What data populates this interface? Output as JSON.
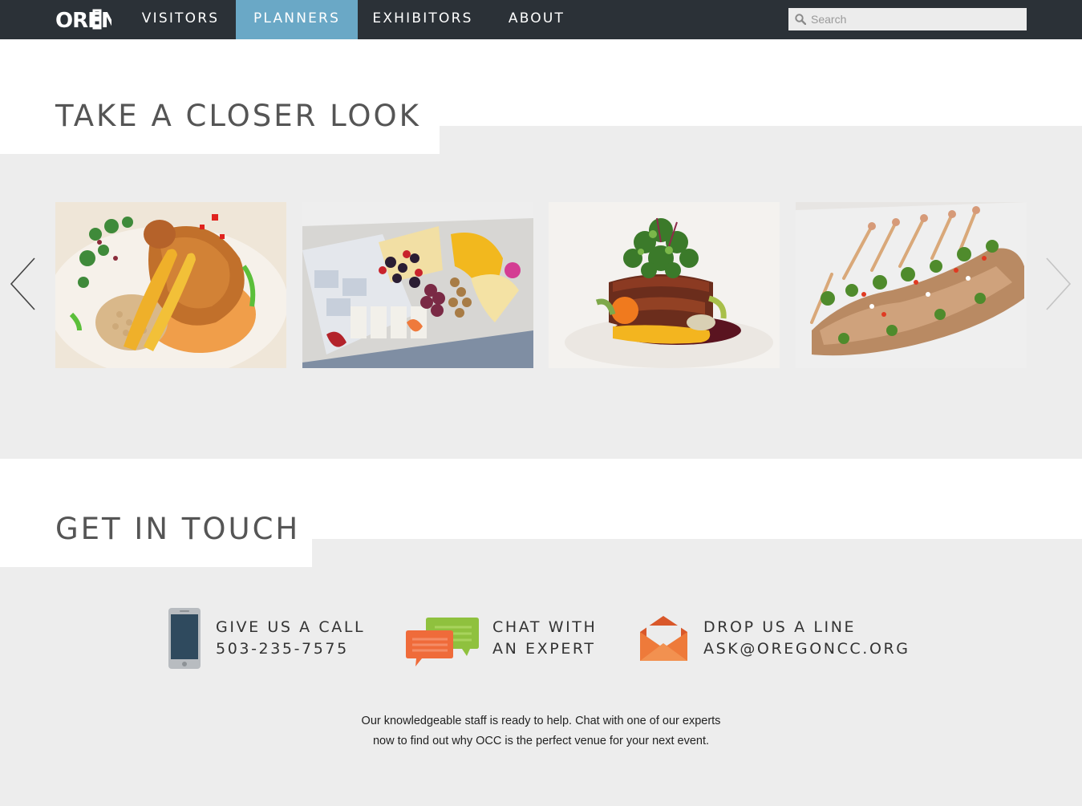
{
  "nav": {
    "logo_text": "OREGON",
    "items": [
      {
        "label": "VISITORS",
        "active": false
      },
      {
        "label": "PLANNERS",
        "active": true
      },
      {
        "label": "EXHIBITORS",
        "active": false
      },
      {
        "label": "ABOUT",
        "active": false
      }
    ],
    "search_placeholder": "Search"
  },
  "gallery": {
    "title": "TAKE A CLOSER LOOK",
    "photos": [
      {
        "subject": "roasted chicken with carrots and couscous"
      },
      {
        "subject": "cheese and fruit platter"
      },
      {
        "subject": "bacon-wrapped filet with microgreens"
      },
      {
        "subject": "chicken skewers with herb salad"
      }
    ]
  },
  "contact": {
    "title": "GET IN TOUCH",
    "call": {
      "line1": "GIVE US A CALL",
      "line2": "503-235-7575"
    },
    "chat": {
      "line1": "CHAT WITH",
      "line2": "AN EXPERT"
    },
    "mail": {
      "line1": "DROP US A LINE",
      "line2": "ASK@OREGONCC.ORG"
    },
    "blurb_line1": "Our knowledgeable staff is ready to help. Chat with one of our experts",
    "blurb_line2": "now to find out why OCC is the perfect venue for your next event."
  },
  "colors": {
    "nav_bg": "#2b3137",
    "nav_active": "#6aa8c6",
    "band_gray": "#ededed",
    "chat_orange": "#ef6b3a",
    "chat_green": "#8fc13e",
    "mail_orange": "#ee7a3a"
  }
}
